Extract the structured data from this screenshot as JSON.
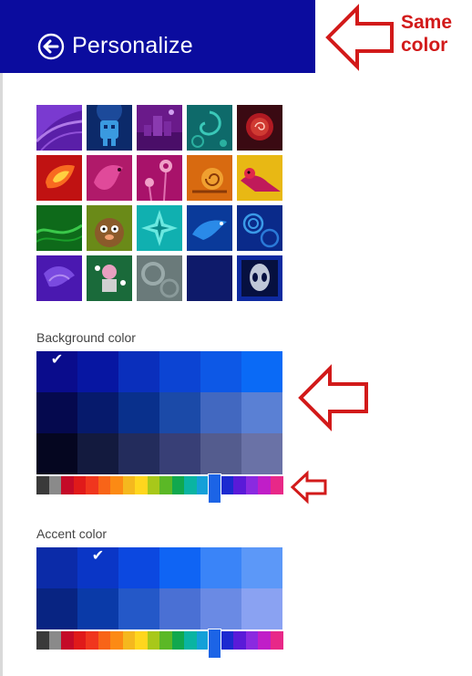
{
  "header": {
    "title": "Personalize",
    "back_label": "Back"
  },
  "annotation": {
    "line1": "Same",
    "line2": "color",
    "color": "#d21a1a"
  },
  "colors": {
    "header_bg": "#0b0c9e",
    "selected_hue": "#1c64e6"
  },
  "tiles": [
    {
      "name": "tile-purple-swirl",
      "icon": "swirl"
    },
    {
      "name": "tile-blue-robot",
      "icon": "robot"
    },
    {
      "name": "tile-purple-castle",
      "icon": "castle"
    },
    {
      "name": "tile-teal-paisley",
      "icon": "paisley"
    },
    {
      "name": "tile-red-rose",
      "icon": "rose"
    },
    {
      "name": "tile-red-drop",
      "icon": "drop"
    },
    {
      "name": "tile-pink-bird",
      "icon": "bird"
    },
    {
      "name": "tile-magenta-flowers",
      "icon": "flowers"
    },
    {
      "name": "tile-orange-snail",
      "icon": "snail"
    },
    {
      "name": "tile-yellow-bird",
      "icon": "bird-yellow"
    },
    {
      "name": "tile-green-waves",
      "icon": "waves"
    },
    {
      "name": "tile-olive-creature",
      "icon": "creature"
    },
    {
      "name": "tile-cyan-star",
      "icon": "star"
    },
    {
      "name": "tile-blue-dragon",
      "icon": "dragon"
    },
    {
      "name": "tile-navy-spirals",
      "icon": "spirals"
    },
    {
      "name": "tile-violet-dragon",
      "icon": "violet-dragon"
    },
    {
      "name": "tile-green-robot",
      "icon": "green-robot"
    },
    {
      "name": "tile-gray-gears",
      "icon": "gears"
    },
    {
      "name": "tile-solid-navy",
      "icon": "solid"
    },
    {
      "name": "tile-alien-logo",
      "icon": "alien"
    }
  ],
  "background_color": {
    "label": "Background color",
    "selected_index": 0,
    "rows": [
      [
        "#0a0c8c",
        "#0716a2",
        "#0a2fbc",
        "#0c44d3",
        "#0d58e6",
        "#0a6af6"
      ],
      [
        "#05094e",
        "#061a6c",
        "#09308c",
        "#1b4aa8",
        "#4268c0",
        "#5a80d4"
      ],
      [
        "#050620",
        "#131a3e",
        "#232c5c",
        "#383f76",
        "#545c8e",
        "#6a72a6"
      ]
    ],
    "hue_strip": {
      "colors": [
        "#3a3a3a",
        "#8a8a8a",
        "#c40a28",
        "#e01a1a",
        "#f0361e",
        "#f86418",
        "#fc8a14",
        "#f5b81e",
        "#ffd61e",
        "#a8c81a",
        "#5bb826",
        "#11a84e",
        "#0ab4a2",
        "#14a0d8",
        "#1c64e6",
        "#1c2ad0",
        "#5a1ad8",
        "#8a2ae0",
        "#c01ec8",
        "#e82888"
      ],
      "selected_index": 14
    }
  },
  "accent_color": {
    "label": "Accent color",
    "selected_index": 1,
    "rows": [
      [
        "#0b2ba8",
        "#0a36c6",
        "#0c48e0",
        "#0f64f4",
        "#3a84f8",
        "#5c98f8"
      ],
      [
        "#082482",
        "#0a3aa8",
        "#2458c8",
        "#4a70d4",
        "#6a8ae4",
        "#8aa2f2"
      ]
    ],
    "hue_strip": {
      "colors": [
        "#3a3a3a",
        "#8a8a8a",
        "#c40a28",
        "#e01a1a",
        "#f0361e",
        "#f86418",
        "#fc8a14",
        "#f5b81e",
        "#ffd61e",
        "#a8c81a",
        "#5bb826",
        "#11a84e",
        "#0ab4a2",
        "#14a0d8",
        "#1c64e6",
        "#1c2ad0",
        "#5a1ad8",
        "#8a2ae0",
        "#c01ec8",
        "#e82888"
      ],
      "selected_index": 14
    }
  }
}
